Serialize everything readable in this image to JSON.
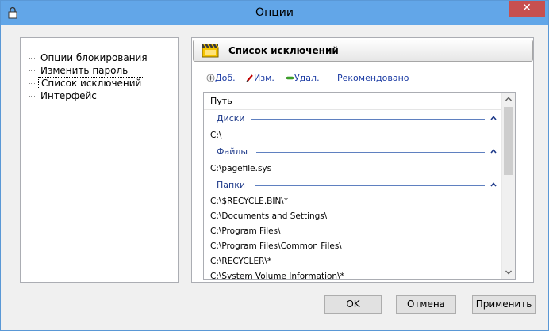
{
  "window": {
    "title": "Опции",
    "close_label": "✕"
  },
  "tree": {
    "items": [
      {
        "label": "Опции блокирования",
        "selected": false
      },
      {
        "label": "Изменить пароль",
        "selected": false
      },
      {
        "label": "Список исключений",
        "selected": true
      },
      {
        "label": "Интерфейс",
        "selected": false
      }
    ]
  },
  "panel": {
    "title": "Список исключений",
    "toolbar": {
      "add": "Доб.",
      "edit": "Изм.",
      "delete": "Удал.",
      "recommended": "Рекомендовано"
    },
    "list": {
      "column_header": "Путь",
      "groups": [
        {
          "title": "Диски",
          "items": [
            "C:\\"
          ]
        },
        {
          "title": "Файлы",
          "items": [
            "C:\\pagefile.sys"
          ]
        },
        {
          "title": "Папки",
          "items": [
            "C:\\$RECYCLE.BIN\\*",
            "C:\\Documents and Settings\\",
            "C:\\Program Files\\",
            "C:\\Program Files\\Common Files\\",
            "C:\\RECYCLER\\*",
            "C:\\System Volume Information\\*"
          ]
        }
      ]
    }
  },
  "buttons": {
    "ok": "OK",
    "cancel": "Отмена",
    "apply": "Применить"
  },
  "colors": {
    "titlebar": "#62a6e8",
    "close": "#c75050",
    "group_title": "#1e3a8a",
    "link": "#1a3aa3"
  }
}
